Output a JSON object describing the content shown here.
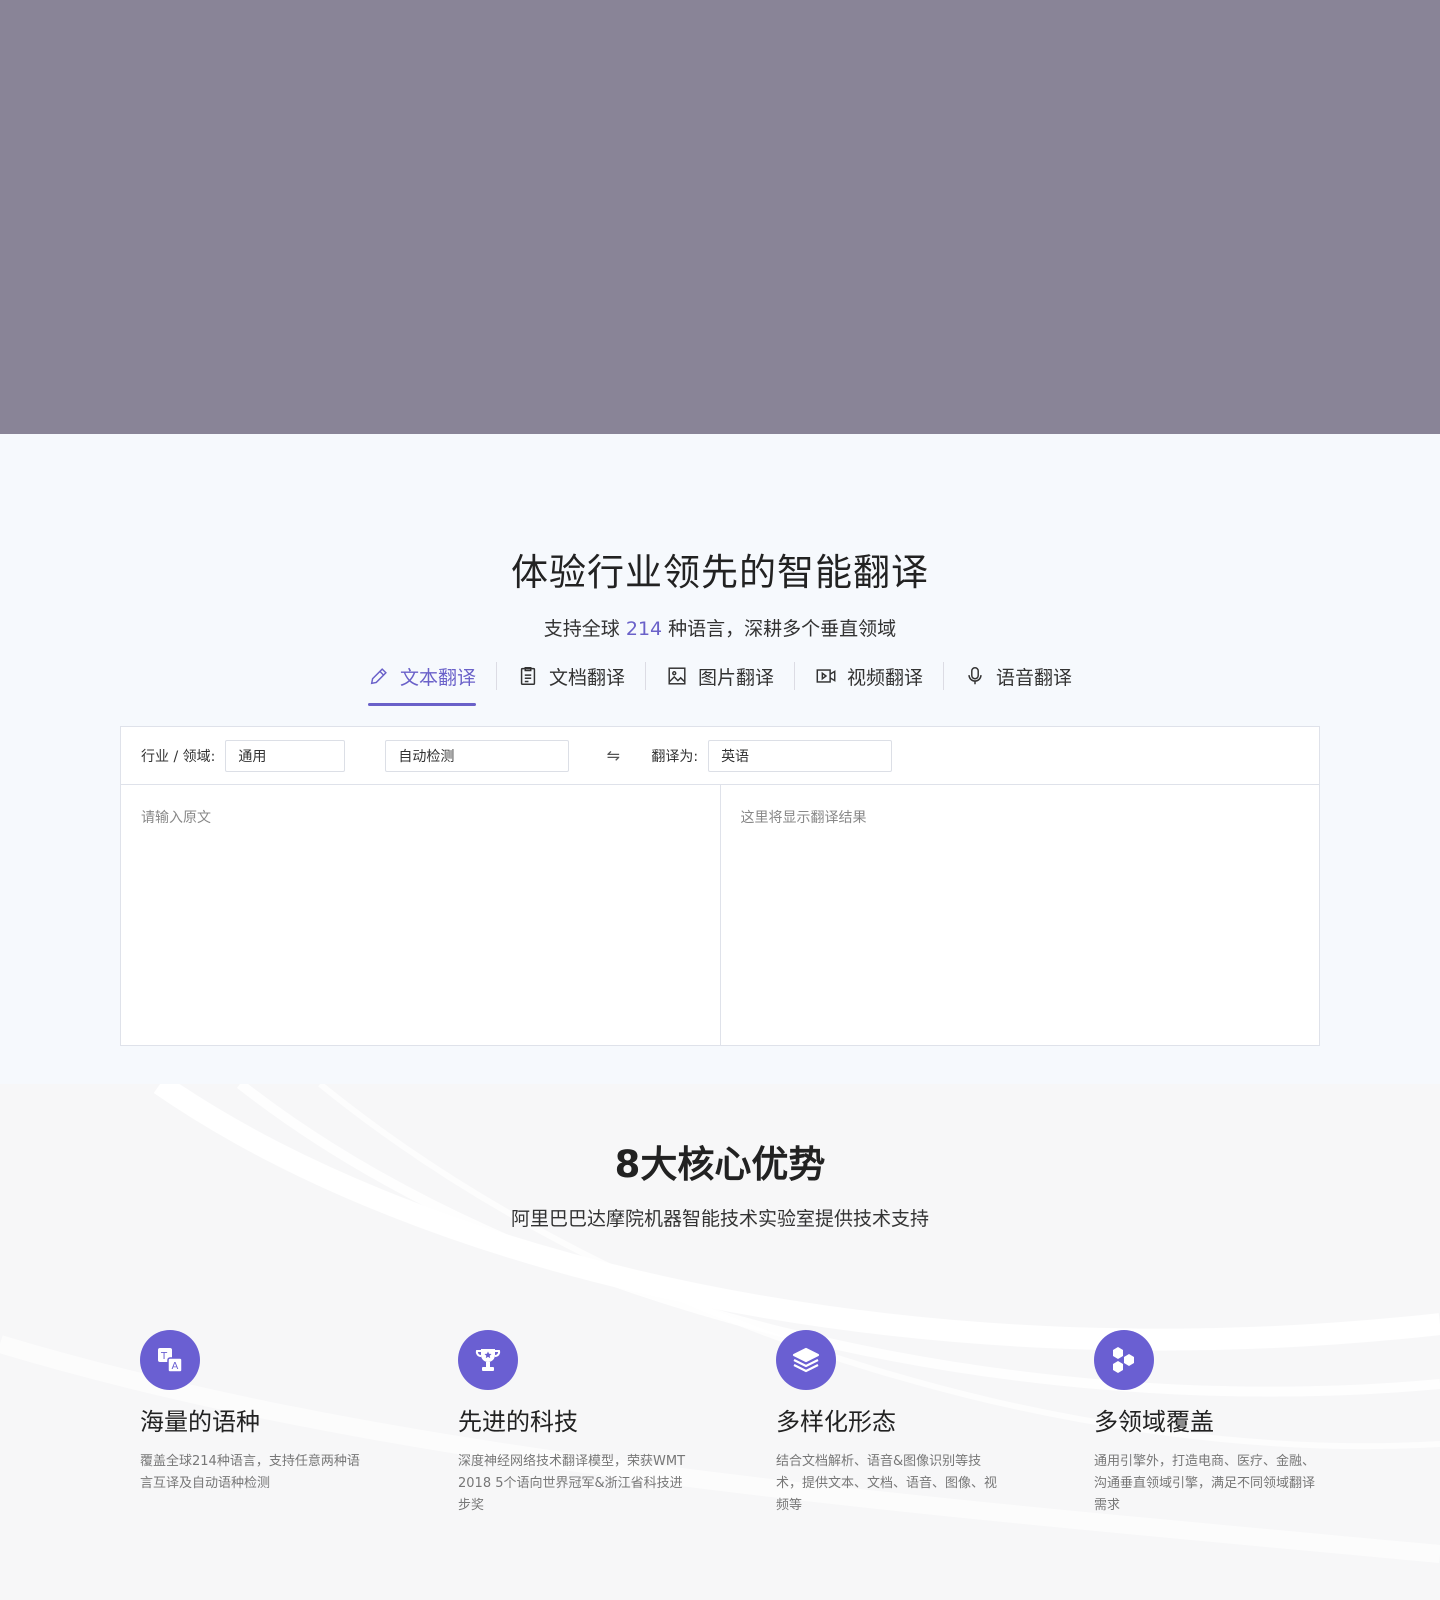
{
  "translate": {
    "title": "体验行业领先的智能翻译",
    "subtitle_pre": "支持全球",
    "subtitle_num": "214",
    "subtitle_post": "种语言，深耕多个垂直领域",
    "tabs": [
      {
        "label": "文本翻译",
        "icon": "pencil-icon",
        "active": true
      },
      {
        "label": "文档翻译",
        "icon": "document-icon",
        "active": false
      },
      {
        "label": "图片翻译",
        "icon": "image-icon",
        "active": false
      },
      {
        "label": "视频翻译",
        "icon": "video-icon",
        "active": false
      },
      {
        "label": "语音翻译",
        "icon": "microphone-icon",
        "active": false
      }
    ],
    "domain_label": "行业 / 领域:",
    "domain_value": "通用",
    "source_lang": "自动检测",
    "swap_icon": "⇋",
    "target_label": "翻译为:",
    "target_lang": "英语",
    "input_placeholder": "请输入原文",
    "output_placeholder": "这里将显示翻译结果"
  },
  "advantages": {
    "title": "8大核心优势",
    "subtitle": "阿里巴巴达摩院机器智能技术实验室提供技术支持",
    "items": [
      {
        "icon": "translate-icon",
        "name": "海量的语种",
        "desc": "覆盖全球214种语言，支持任意两种语言互译及自动语种检测"
      },
      {
        "icon": "trophy-icon",
        "name": "先进的科技",
        "desc": "深度神经网络技术翻译模型，荣获WMT 2018 5个语向世界冠军&浙江省科技进步奖"
      },
      {
        "icon": "layers-icon",
        "name": "多样化形态",
        "desc": "结合文档解析、语音&图像识别等技术，提供文本、文档、语音、图像、视频等"
      },
      {
        "icon": "hexagons-icon",
        "name": "多领域覆盖",
        "desc": "通用引擎外，打造电商、医疗、金融、沟通垂直领域引擎，满足不同领域翻译需求"
      }
    ]
  },
  "colors": {
    "accent": "#6a61c9",
    "hero_bg": "#898497",
    "icon_bg": "#6a5fd2"
  }
}
